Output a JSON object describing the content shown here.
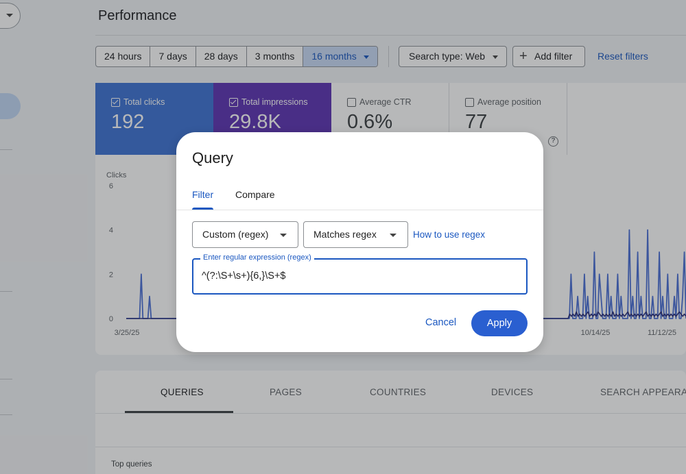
{
  "header": {
    "title": "Performance"
  },
  "date_range": {
    "options": [
      "24 hours",
      "7 days",
      "28 days",
      "3 months",
      "16 months"
    ],
    "selected_index": 4
  },
  "filters": {
    "search_type": "Search type: Web",
    "add_filter": "Add filter",
    "reset": "Reset filters"
  },
  "metrics": {
    "clicks": {
      "label": "Total clicks",
      "value": "192",
      "checked": true,
      "color": "#3e74d4"
    },
    "impressions": {
      "label": "Total impressions",
      "value": "29.8K",
      "checked": true,
      "color": "#5e34b4"
    },
    "ctr": {
      "label": "Average CTR",
      "value": "0.6%",
      "checked": false
    },
    "position": {
      "label": "Average position",
      "value": "77",
      "checked": false
    }
  },
  "chart_data": {
    "type": "line",
    "ylabel": "Clicks",
    "y_ticks": [
      "6",
      "4",
      "2",
      "0"
    ],
    "ylim": [
      0,
      6
    ],
    "x_ticks": [
      "3/25/25",
      "10/14/25",
      "11/12/25"
    ],
    "grid": false,
    "series": [
      {
        "color": "#4a6fd6",
        "values": [
          0,
          0,
          0,
          0,
          0,
          0,
          0,
          0,
          0,
          2,
          0,
          0,
          0,
          0,
          1,
          0,
          0,
          0,
          0,
          0,
          0,
          0,
          0,
          0,
          0,
          0,
          0,
          0,
          0,
          0,
          0,
          0,
          0,
          0,
          0,
          0,
          0,
          0,
          0,
          0,
          0,
          0,
          0,
          0,
          0,
          0,
          0,
          0,
          0,
          0,
          0,
          0,
          0,
          0,
          0,
          0,
          0,
          0,
          0,
          0,
          0,
          0,
          0,
          0,
          0,
          0,
          0,
          0,
          0,
          0,
          0,
          0,
          0,
          0,
          0,
          0,
          0,
          0,
          0,
          0,
          0,
          0,
          0,
          0,
          0,
          0,
          0,
          0,
          0,
          0,
          0,
          0,
          0,
          0,
          0,
          0,
          0,
          0,
          0,
          0,
          0,
          0,
          0,
          0,
          0,
          0,
          0,
          0,
          0,
          0,
          0,
          0,
          0,
          0,
          0,
          0,
          0,
          0,
          0,
          0,
          0,
          0,
          0,
          0,
          0,
          0,
          0,
          0,
          0,
          0,
          0,
          0,
          0,
          0,
          0,
          0,
          0,
          0,
          0,
          0,
          0,
          0,
          0,
          0,
          0,
          0,
          0,
          0,
          0,
          0,
          0,
          0,
          0,
          0,
          0,
          0,
          0,
          0,
          0,
          0,
          0,
          0,
          0,
          0,
          0,
          0,
          0,
          0,
          0,
          0,
          0,
          0,
          0,
          0,
          0,
          0,
          0,
          0,
          0,
          0,
          0,
          0,
          0,
          0,
          0,
          0,
          0,
          0,
          0,
          0,
          0,
          0,
          0,
          0,
          0,
          0,
          0,
          0,
          0,
          0,
          0,
          0,
          0,
          0,
          0,
          0,
          0,
          0,
          0,
          0,
          0,
          0,
          0,
          0,
          0,
          0,
          0,
          0,
          0,
          0,
          0,
          0,
          0,
          0,
          0,
          0,
          0,
          0,
          0,
          0,
          0,
          0,
          0,
          0,
          0,
          0,
          0,
          0,
          0,
          0,
          0,
          0,
          0,
          0,
          0,
          0,
          0,
          0,
          0,
          0,
          0,
          0,
          0,
          0,
          0,
          0,
          0,
          0,
          0,
          0,
          0,
          0,
          0,
          0,
          0,
          0,
          0,
          2,
          0,
          0,
          0,
          1,
          0,
          0,
          0,
          2,
          0,
          1,
          0,
          0,
          0,
          3,
          0,
          0,
          2,
          1,
          0,
          0,
          0,
          2,
          0,
          1,
          0,
          0,
          0,
          2,
          0,
          1,
          0,
          0,
          0,
          0,
          4,
          0,
          1,
          0,
          0,
          3,
          0,
          1,
          0,
          0,
          0,
          4,
          0,
          0,
          1,
          0,
          0,
          0,
          3,
          0,
          1,
          0,
          0,
          2,
          0,
          0,
          0,
          1,
          0,
          2,
          0,
          0,
          1,
          3,
          0
        ]
      },
      {
        "color": "#2a2f7a",
        "values": [
          0,
          0,
          0,
          0,
          0,
          0,
          0,
          0,
          0,
          0,
          0,
          0,
          0,
          0,
          0,
          0,
          0,
          0,
          0,
          0,
          0,
          0,
          0,
          0,
          0,
          0,
          0,
          0,
          0,
          0,
          0,
          0,
          0,
          0,
          0,
          0,
          0,
          0,
          0,
          0,
          0,
          0,
          0,
          0,
          0,
          0,
          0,
          0,
          0,
          0,
          0,
          0,
          0,
          0,
          0,
          0,
          0,
          0,
          0,
          0,
          0,
          0,
          0,
          0,
          0,
          0,
          0,
          0,
          0,
          0,
          0,
          0,
          0,
          0,
          0,
          0,
          0,
          0,
          0,
          0,
          0,
          0,
          0,
          0,
          0,
          0,
          0,
          0,
          0,
          0,
          0,
          0,
          0,
          0,
          0,
          0,
          0,
          0,
          0,
          0,
          0,
          0,
          0,
          0,
          0,
          0,
          0,
          0,
          0,
          0,
          0,
          0,
          0,
          0,
          0,
          0,
          0,
          0,
          0,
          0,
          0,
          0,
          0,
          0,
          0,
          0,
          0,
          0,
          0,
          0,
          0,
          0,
          0,
          0,
          0,
          0,
          0,
          0,
          0,
          0,
          0,
          0,
          0,
          0,
          0,
          0,
          0,
          0,
          0,
          0,
          0,
          0,
          0,
          0,
          0,
          0,
          0,
          0,
          0,
          0,
          0,
          0,
          0,
          0,
          0,
          0,
          0,
          0,
          0,
          0,
          0,
          0,
          0,
          0,
          0,
          0,
          0,
          0,
          0,
          0,
          0,
          0,
          0,
          0,
          0,
          0,
          0,
          0,
          0,
          0,
          0,
          0,
          0,
          0,
          0,
          0,
          0,
          0,
          0,
          0,
          0,
          0,
          0,
          0,
          0,
          0,
          0,
          0,
          0,
          0,
          0,
          0,
          0,
          0,
          0,
          0,
          0,
          0,
          0,
          0,
          0,
          0,
          0,
          0,
          0,
          0,
          0,
          0,
          0,
          0,
          0,
          0,
          0,
          0,
          0,
          0,
          0,
          0,
          0,
          0,
          0,
          0,
          0,
          0,
          0,
          0,
          0,
          0,
          0,
          0,
          0,
          0,
          0,
          0,
          0,
          0,
          0,
          0,
          0,
          0,
          0,
          0,
          0,
          0,
          0,
          0,
          0,
          0.2,
          0.1,
          0.2,
          0.1,
          0.3,
          0.1,
          0.2,
          0.1,
          0.2,
          0.1,
          0.2,
          0.3,
          0.1,
          0.2,
          0.1,
          0.2,
          0.1,
          0.3,
          0.2,
          0.1,
          0.2,
          0.1,
          0.2,
          0.1,
          0.2,
          0.1,
          0.3,
          0.1,
          0.2,
          0.1,
          0.2,
          0.1,
          0.2,
          0.1,
          0.2,
          0.3,
          0.1,
          0.2,
          0.1,
          0.2,
          0.1,
          0.2,
          0.1,
          0.2,
          0.1,
          0.2,
          0.3,
          0.1,
          0.2,
          0.1,
          0.2,
          0.1,
          0.2,
          0.1,
          0.2,
          0.3,
          0.1,
          0.2,
          0.1,
          0.2,
          0.1,
          0.2,
          0.1,
          0.2,
          0.1,
          0.2,
          0.3,
          0.2,
          0.1,
          0.2,
          0.1
        ]
      }
    ]
  },
  "table_tabs": [
    "QUERIES",
    "PAGES",
    "COUNTRIES",
    "DEVICES",
    "SEARCH APPEARANC"
  ],
  "table": {
    "title": "Top queries"
  },
  "dialog": {
    "title": "Query",
    "tabs": [
      "Filter",
      "Compare"
    ],
    "dimension": "Custom (regex)",
    "operator": "Matches regex",
    "help_link": "How to use regex",
    "field_label": "Enter regular expression (regex)",
    "field_value": "^(?:\\S+\\s+){6,}\\S+$",
    "cancel": "Cancel",
    "apply": "Apply"
  }
}
